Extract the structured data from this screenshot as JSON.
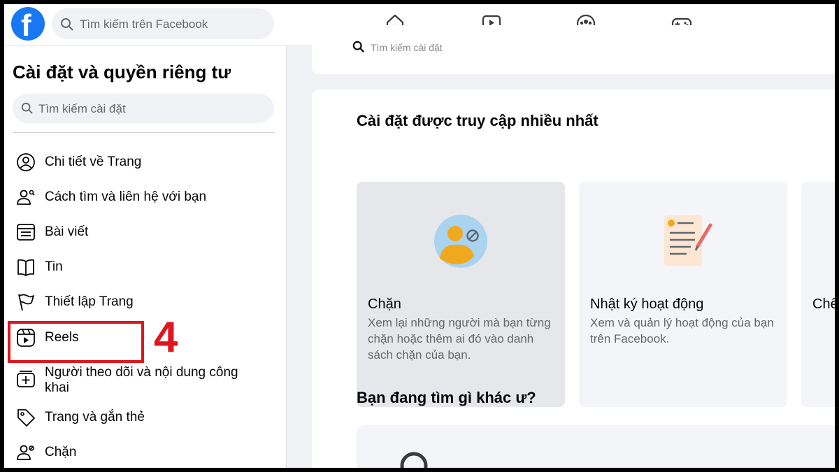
{
  "topbar": {
    "logo_letter": "f",
    "search_placeholder": "Tìm kiếm trên Facebook",
    "nav_icons": [
      "home-icon",
      "watch-icon",
      "groups-icon",
      "gaming-icon"
    ]
  },
  "sidebar": {
    "title": "Cài đặt và quyền riêng tư",
    "search_placeholder": "Tìm kiếm cài đặt",
    "items": [
      {
        "label": "Chi tiết về Trang",
        "icon": "profile-circle-icon"
      },
      {
        "label": "Cách tìm và liên hệ với bạn",
        "icon": "people-contact-icon"
      },
      {
        "label": "Bài viết",
        "icon": "posts-icon"
      },
      {
        "label": "Tin",
        "icon": "book-icon"
      },
      {
        "label": "Thiết lập Trang",
        "icon": "flag-icon"
      },
      {
        "label": "Reels",
        "icon": "reels-icon"
      },
      {
        "label": "Người theo dõi và nội dung công khai",
        "icon": "followers-icon"
      },
      {
        "label": "Trang và gắn thẻ",
        "icon": "tag-icon"
      },
      {
        "label": "Chặn",
        "icon": "block-user-icon"
      }
    ]
  },
  "annotation": {
    "step_number": "4",
    "color": "#e0161f"
  },
  "main": {
    "top_search_placeholder": "Tìm kiếm cài đặt",
    "most_visited_title": "Cài đặt được truy cập nhiều nhất",
    "tiles": [
      {
        "title": "Chặn",
        "description": "Xem lại những người mà bạn từng chặn hoặc thêm ai đó vào danh sách chặn của bạn.",
        "icon": "block-illustration"
      },
      {
        "title": "Nhật ký hoạt động",
        "description": "Xem và quản lý hoạt động của bạn trên Facebook.",
        "icon": "activity-log-illustration"
      },
      {
        "title": "Chế",
        "description": "",
        "icon": ""
      }
    ],
    "other_title": "Bạn đang tìm gì khác ư?"
  },
  "colors": {
    "facebook_blue": "#1877f2",
    "background_grey": "#f0f2f5"
  }
}
